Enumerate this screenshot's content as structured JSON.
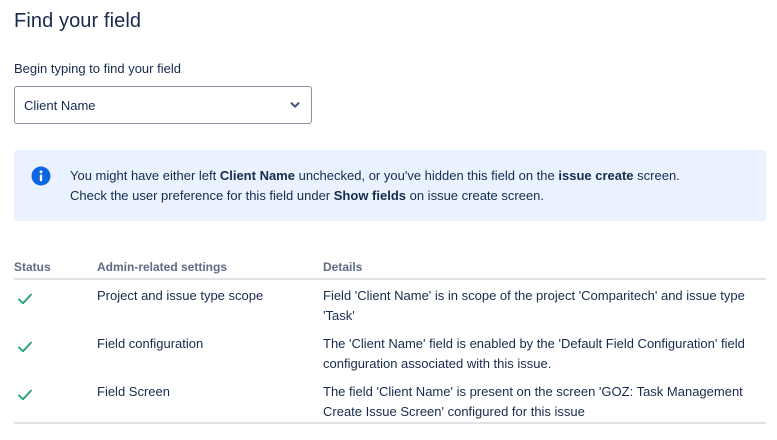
{
  "page": {
    "title": "Find your field",
    "field_label": "Begin typing to find your field",
    "selected_field": "Client Name"
  },
  "banner": {
    "line1_pre": "You might have either left ",
    "line1_bold1": "Client Name",
    "line1_mid": " unchecked, or you've hidden this field on the ",
    "line1_bold2": "issue create",
    "line1_post": " screen.",
    "line2_pre": "Check the user preference for this field under ",
    "line2_bold": "Show fields",
    "line2_post": " on issue create screen."
  },
  "table": {
    "headers": [
      "Status",
      "Admin-related settings",
      "Details"
    ],
    "rows": [
      {
        "setting": "Project and issue type scope",
        "details": "Field 'Client Name' is in scope of the project 'Comparitech' and issue type 'Task'"
      },
      {
        "setting": "Field configuration",
        "details": "The 'Client Name' field is enabled by the 'Default Field Configuration' field configuration associated with this issue."
      },
      {
        "setting": "Field Screen",
        "details": "The field 'Client Name' is present on the screen 'GOZ: Task Management Create Issue Screen' configured for this issue"
      }
    ]
  },
  "colors": {
    "check": "#22a06b",
    "info": "#0c66e4",
    "banner_bg": "#e9f2fe"
  },
  "icons": {
    "select": "chevron-down-icon",
    "banner": "info-icon",
    "status": "check-icon"
  }
}
